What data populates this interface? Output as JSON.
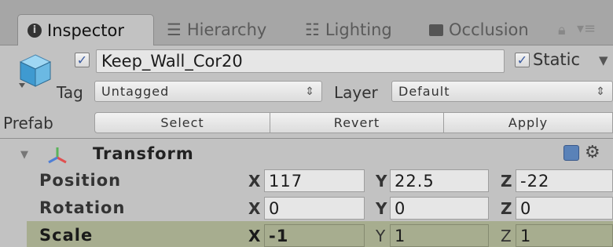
{
  "tabs": [
    {
      "label": "Inspector",
      "icon": "info-icon",
      "active": true
    },
    {
      "label": "Hierarchy",
      "icon": "hierarchy-icon",
      "active": false
    },
    {
      "label": "Lighting",
      "icon": "lighting-icon",
      "active": false
    },
    {
      "label": "Occlusion",
      "icon": "occlusion-icon",
      "active": false
    }
  ],
  "header": {
    "object_name": "Keep_Wall_Cor20",
    "active_checked": true,
    "static_label": "Static",
    "static_checked": true,
    "tag_label": "Tag",
    "tag_value": "Untagged",
    "layer_label": "Layer",
    "layer_value": "Default"
  },
  "prefab": {
    "label": "Prefab",
    "select": "Select",
    "revert": "Revert",
    "apply": "Apply"
  },
  "transform": {
    "title": "Transform",
    "rows": [
      {
        "label": "Position",
        "x": "117",
        "y": "22.5",
        "z": "-22"
      },
      {
        "label": "Rotation",
        "x": "0",
        "y": "0",
        "z": "0"
      },
      {
        "label": "Scale",
        "x": "-1",
        "y": "1",
        "z": "1"
      }
    ],
    "axes": {
      "x": "X",
      "y": "Y",
      "z": "Z"
    }
  },
  "colors": {
    "accent": "#3a5aa0",
    "scale_highlight": "#a7ad8f"
  }
}
